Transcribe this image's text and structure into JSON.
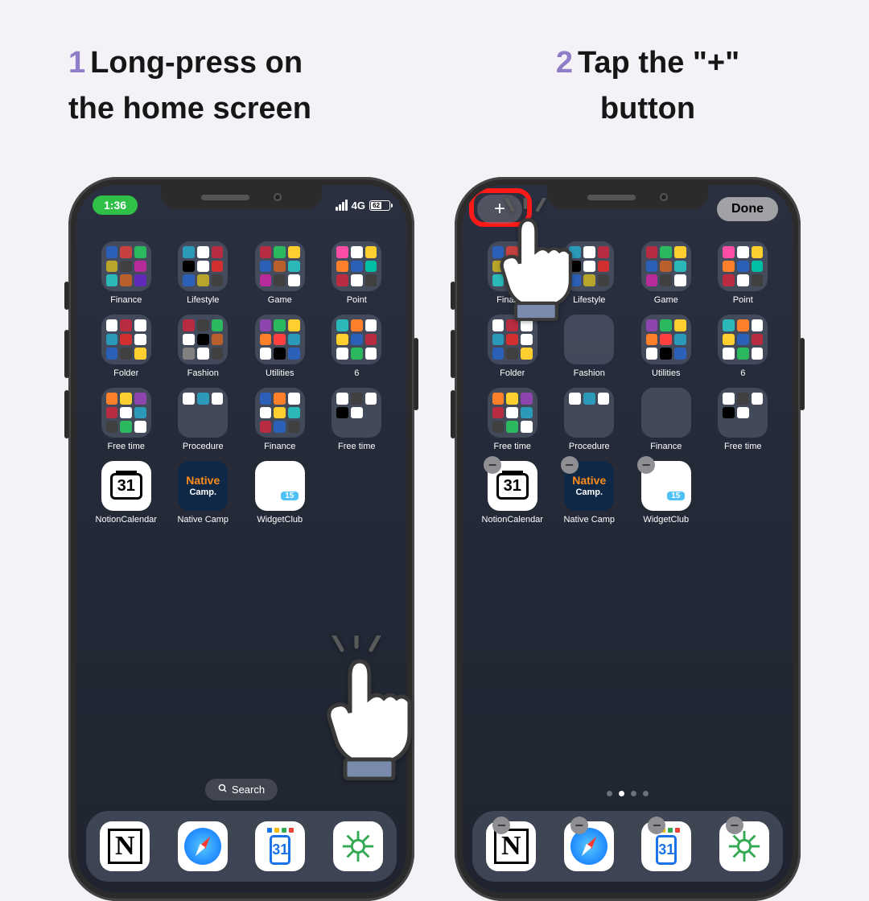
{
  "step1": {
    "num": "1",
    "text_a": "Long-press on",
    "text_b": "the home screen"
  },
  "step2": {
    "num": "2",
    "text_a": "Tap the \"+\"",
    "text_b": "button"
  },
  "status": {
    "time": "1:36",
    "net": "4G",
    "battery": "62"
  },
  "edit": {
    "plus": "+",
    "done": "Done"
  },
  "folders_row1": [
    "Finance",
    "Lifestyle",
    "Game",
    "Point"
  ],
  "folders_row2": [
    "Folder",
    "Fashion",
    "Utilities",
    "6"
  ],
  "folders_row3": [
    "Free time",
    "Procedure",
    "Finance",
    "Free time"
  ],
  "apps_row": [
    {
      "name": "NotionCalendar"
    },
    {
      "name": "Native Camp"
    },
    {
      "name": "WidgetClub"
    }
  ],
  "search": "Search",
  "dock": [
    "Notion",
    "Safari",
    "Calendar",
    "Claude"
  ],
  "folder_colors": {
    "Finance": [
      "#2b5fb8",
      "#c84040",
      "#2bb85f",
      "#b8a52b",
      "#404040",
      "#b82b9a",
      "#2bb8b8",
      "#b85f2b",
      "#5f2bb8"
    ],
    "Lifestyle": [
      "#2b9ab8",
      "#ffffff",
      "#b82b40",
      "#000000",
      "#ffffff",
      "#d03030",
      "#2b5fb8",
      "#b8a52b",
      "#404040"
    ],
    "Game": [
      "#b82b40",
      "#2bb85f",
      "#ffcf30",
      "#2b5fb8",
      "#b85f2b",
      "#2bb8b8",
      "#b82b9a",
      "#404040",
      "#ffffff"
    ],
    "Point": [
      "#ff4da6",
      "#ffffff",
      "#ffcf30",
      "#ff7f2b",
      "#2b5fb8",
      "#00bfa5",
      "#b82b40",
      "#ffffff",
      "#404040"
    ],
    "Folder": [
      "#ffffff",
      "#b82b40",
      "#ffffff",
      "#2b9ab8",
      "#d03030",
      "#ffffff",
      "#2b5fb8",
      "#404040",
      "#ffcf30"
    ],
    "Fashion": [
      "#b82b40",
      "#404040",
      "#2bb85f",
      "#ffffff",
      "#000000",
      "#b85f2b",
      "#808080",
      "#ffffff",
      "#404040"
    ],
    "Utilities": [
      "#8e44ad",
      "#2bb85f",
      "#ffcf30",
      "#ff7f2b",
      "#ff4040",
      "#2b9ab8",
      "#ffffff",
      "#000000",
      "#2b5fb8"
    ],
    "6": [
      "#2bb8b8",
      "#ff7f2b",
      "#ffffff",
      "#ffcf30",
      "#2b5fb8",
      "#b82b40",
      "#ffffff",
      "#2bb85f",
      "#ffffff"
    ],
    "Free time": [
      "#ff7f2b",
      "#ffcf30",
      "#8e44ad",
      "#b82b40",
      "#ffffff",
      "#2b9ab8",
      "#404040",
      "#2bb85f",
      "#ffffff"
    ],
    "Procedure": [
      "#ffffff",
      "#2b9ab8",
      "#ffffff",
      "transparent",
      "transparent",
      "transparent",
      "transparent",
      "transparent",
      "transparent"
    ],
    "Finance2": [
      "#2b5fb8",
      "#ff7f2b",
      "#ffffff",
      "#ffffff",
      "#ffcf30",
      "#2bb8b8",
      "#b82b40",
      "#2b5fb8",
      "#404040"
    ],
    "Free time2": [
      "#ffffff",
      "#404040",
      "#ffffff",
      "#000000",
      "#ffffff",
      "transparent",
      "transparent",
      "transparent",
      "transparent"
    ]
  }
}
